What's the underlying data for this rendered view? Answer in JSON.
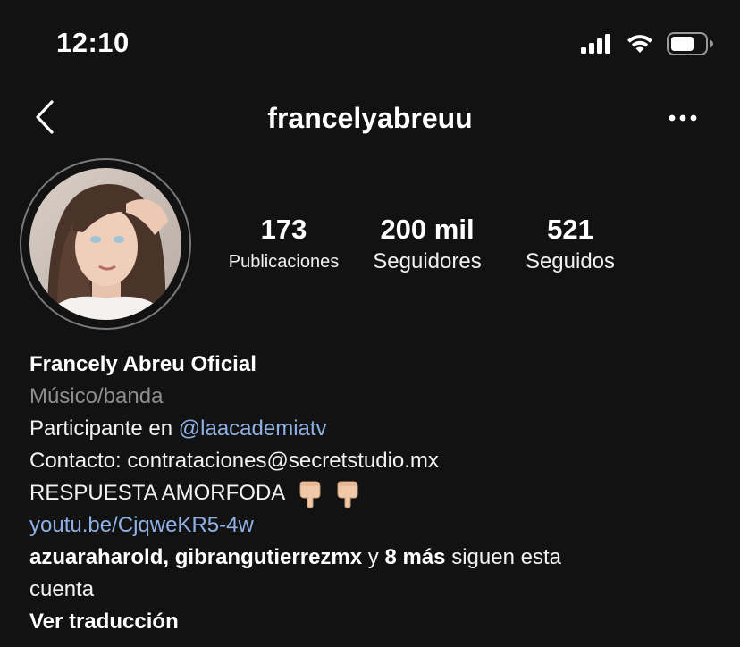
{
  "status_bar": {
    "time": "12:10"
  },
  "header": {
    "username": "francelyabreuu"
  },
  "stats": [
    {
      "value": "173",
      "label": "Publicaciones"
    },
    {
      "value": "200 mil",
      "label": "Seguidores"
    },
    {
      "value": "521",
      "label": "Seguidos"
    }
  ],
  "bio": {
    "name": "Francely Abreu Oficial",
    "category": "Músico/banda",
    "participant_prefix": "Participante en ",
    "participant_mention": "@laacademiatv",
    "contact": "Contacto: contrataciones@secretstudio.mx",
    "respuesta": "RESPUESTA AMORFODA",
    "link": "youtu.be/CjqweKR5-4w",
    "followed_by_user1": "azuaraharold",
    "followed_by_sep": ", ",
    "followed_by_user2": "gibrangutierrezmx",
    "followed_by_y": " y ",
    "followed_by_more": "8 más",
    "followed_by_suffix": " siguen esta",
    "followed_by_suffix2": "cuenta",
    "translate": "Ver traducción"
  },
  "icons": {
    "back": "chevron-left-icon",
    "more": "more-horizontal-icon",
    "signal": "cellular-signal-icon",
    "wifi": "wifi-icon",
    "battery": "battery-icon",
    "emoji": "pointing-down-hand-emoji"
  },
  "colors": {
    "background": "#121212",
    "link": "#8fb1e6",
    "muted": "#8e8e8e"
  }
}
